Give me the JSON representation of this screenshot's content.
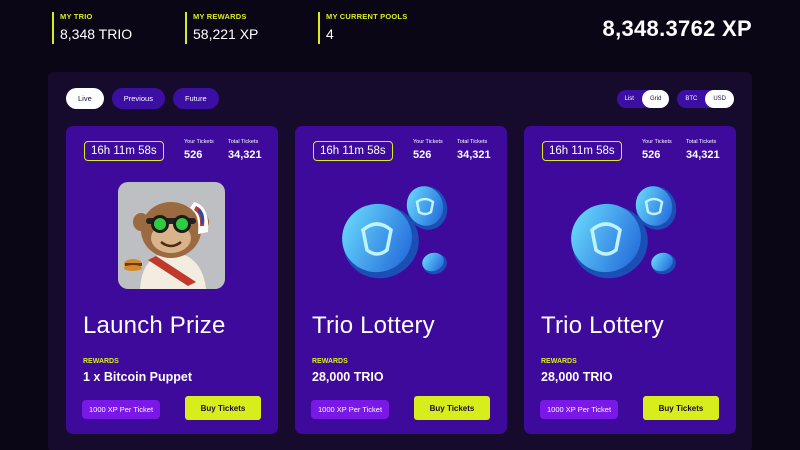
{
  "stats": {
    "trio_label": "MY TRIO",
    "trio_value": "8,348 TRIO",
    "rewards_label": "MY REWARDS",
    "rewards_value": "58,221 XP",
    "pools_label": "MY CURRENT POOLS",
    "pools_value": "4",
    "xp_total": "8,348.3762 XP"
  },
  "filters": {
    "live": "Live",
    "previous": "Previous",
    "future": "Future",
    "active": "Live"
  },
  "view_toggle": {
    "list": "List",
    "grid": "Grid",
    "active": "Grid"
  },
  "currency_toggle": {
    "btc": "BTC",
    "usd": "USD",
    "active": "USD"
  },
  "colors": {
    "accent": "#d8ee1c",
    "card_bg": "#3e0a9c",
    "pill_bg": "#3c0fa4",
    "price_bg": "#7a18e8",
    "page_bg": "#0b0616"
  },
  "cards": [
    {
      "timer": "16h 11m 58s",
      "your_tickets_label": "Your Tickets",
      "your_tickets": "526",
      "total_tickets_label": "Total Tickets",
      "total_tickets": "34,321",
      "art": "monkey-puppet-image",
      "title": "Launch Prize",
      "rewards_label": "REWARDS",
      "rewards_value": "1 x Bitcoin Puppet",
      "price": "1000 XP Per Ticket",
      "buy_label": "Buy Tickets"
    },
    {
      "timer": "16h 11m 58s",
      "your_tickets_label": "Your Tickets",
      "your_tickets": "526",
      "total_tickets_label": "Total Tickets",
      "total_tickets": "34,321",
      "art": "trio-coins-image",
      "title": "Trio Lottery",
      "rewards_label": "REWARDS",
      "rewards_value": "28,000 TRIO",
      "price": "1000 XP Per Ticket",
      "buy_label": "Buy Tickets"
    },
    {
      "timer": "16h 11m 58s",
      "your_tickets_label": "Your Tickets",
      "your_tickets": "526",
      "total_tickets_label": "Total Tickets",
      "total_tickets": "34,321",
      "art": "trio-coins-image",
      "title": "Trio Lottery",
      "rewards_label": "REWARDS",
      "rewards_value": "28,000 TRIO",
      "price": "1000 XP Per Ticket",
      "buy_label": "Buy Tickets"
    }
  ]
}
